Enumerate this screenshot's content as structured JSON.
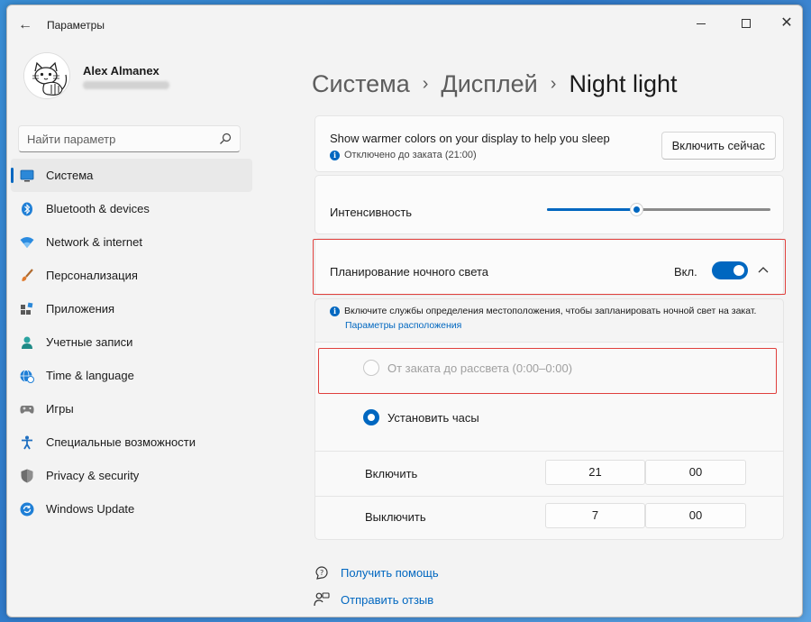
{
  "window": {
    "title": "Параметры",
    "back_glyph": "←",
    "close_glyph": "✕"
  },
  "user": {
    "name": "Alex Almanex"
  },
  "search": {
    "placeholder": "Найти параметр",
    "icon": "search-icon"
  },
  "sidebar": {
    "items": [
      {
        "label": "Система",
        "icon": "monitor-icon",
        "active": true
      },
      {
        "label": "Bluetooth & devices",
        "icon": "bluetooth-icon"
      },
      {
        "label": "Network & internet",
        "icon": "wifi-icon"
      },
      {
        "label": "Персонализация",
        "icon": "brush-icon"
      },
      {
        "label": "Приложения",
        "icon": "apps-icon"
      },
      {
        "label": "Учетные записи",
        "icon": "person-icon"
      },
      {
        "label": "Time & language",
        "icon": "globe-clock-icon"
      },
      {
        "label": "Игры",
        "icon": "gamepad-icon"
      },
      {
        "label": "Специальные возможности",
        "icon": "accessibility-icon"
      },
      {
        "label": "Privacy & security",
        "icon": "shield-icon"
      },
      {
        "label": "Windows Update",
        "icon": "update-icon"
      }
    ]
  },
  "breadcrumb": {
    "items": [
      "Система",
      "Дисплей",
      "Night light"
    ],
    "separator": "›"
  },
  "night_light": {
    "description": "Show warmer colors on your display to help you sleep",
    "status": "Отключено до заката (21:00)",
    "enable_now_button": "Включить сейчас",
    "intensity_label": "Интенсивность",
    "intensity_value": 0.4,
    "schedule_label": "Планирование ночного света",
    "schedule_state": "Вкл.",
    "schedule_enabled": true,
    "location_info": "Включите службы определения местоположения, чтобы запланировать ночной свет на закат.",
    "location_link": "Параметры расположения",
    "option_sunset": "От заката до рассвета (0:00–0:00)",
    "option_sunset_disabled": true,
    "option_hours": "Установить часы",
    "selected_option": "hours",
    "turn_on_label": "Включить",
    "turn_on_hour": "21",
    "turn_on_minute": "00",
    "turn_off_label": "Выключить",
    "turn_off_hour": "7",
    "turn_off_minute": "00"
  },
  "footer": {
    "help_link": "Получить помощь",
    "feedback_link": "Отправить отзыв"
  },
  "colors": {
    "accent": "#0067c0",
    "highlight": "#e0403d",
    "window_bg": "#f3f3f3",
    "card_bg": "#fbfbfb"
  }
}
